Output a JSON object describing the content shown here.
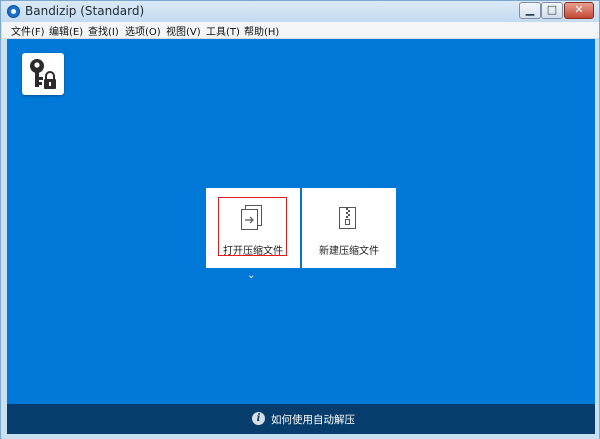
{
  "window": {
    "title": "Bandizip (Standard)",
    "minimize_glyph": "▁",
    "maximize_glyph": "□",
    "close_glyph": "✕"
  },
  "menu": {
    "items": [
      "文件(F)",
      "编辑(E)",
      "查找(I)",
      "选项(O)",
      "视图(V)",
      "工具(T)",
      "帮助(H)"
    ]
  },
  "main": {
    "background_color": "#0078d7",
    "key_icon": "key-lock-icon",
    "cards": [
      {
        "label": "打开压缩文件",
        "icon": "open-archive-icon",
        "highlighted": true
      },
      {
        "label": "新建压缩文件",
        "icon": "new-archive-icon",
        "highlighted": false
      }
    ],
    "chevron_glyph": "⌄"
  },
  "footer": {
    "info_glyph": "i",
    "text": "如何使用自动解压"
  },
  "colors": {
    "accent": "#0078d7",
    "footer": "#063d6c",
    "highlight": "#e01b1b"
  }
}
